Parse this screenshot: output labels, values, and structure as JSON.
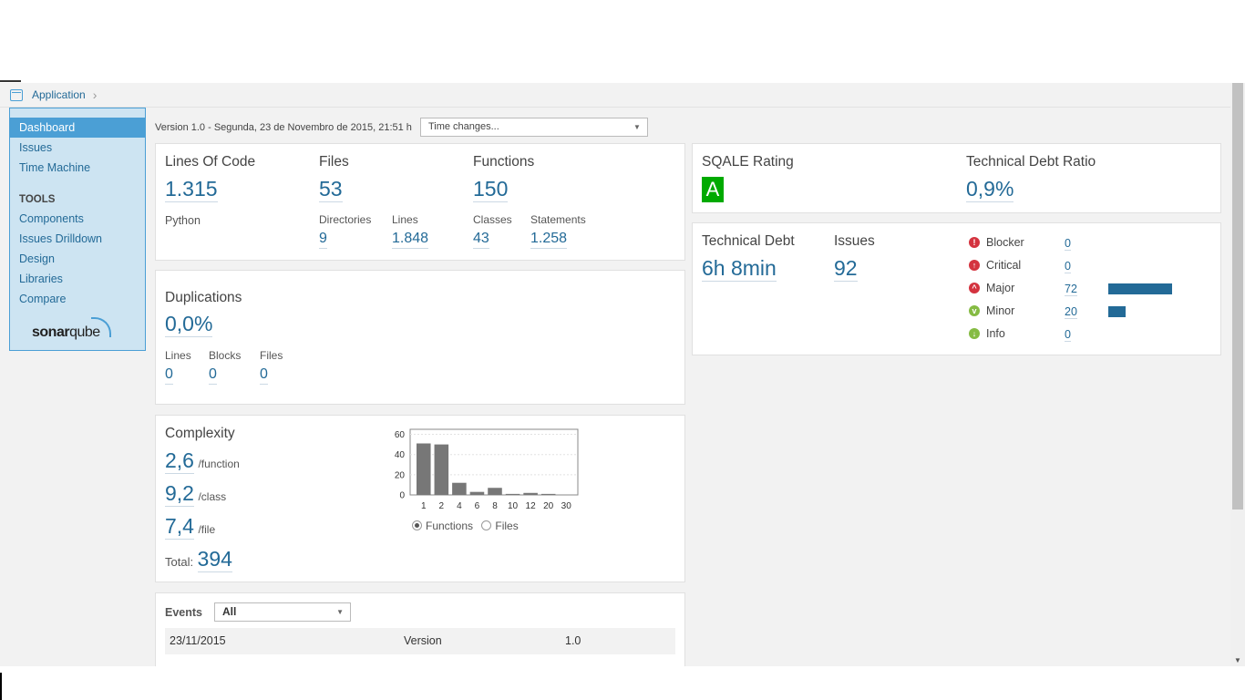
{
  "breadcrumb": {
    "label": "Application"
  },
  "sidebar": {
    "items": [
      {
        "label": "Dashboard"
      },
      {
        "label": "Issues"
      },
      {
        "label": "Time Machine"
      }
    ],
    "tools_label": "TOOLS",
    "tools": [
      {
        "label": "Components"
      },
      {
        "label": "Issues Drilldown"
      },
      {
        "label": "Design"
      },
      {
        "label": "Libraries"
      },
      {
        "label": "Compare"
      }
    ],
    "logo": {
      "part1": "sonar",
      "part2": "qube"
    }
  },
  "version": {
    "text": "Version 1.0 - Segunda, 23 de Novembro de 2015, 21:51 h",
    "select_value": "Time changes..."
  },
  "size": {
    "loc_label": "Lines Of Code",
    "loc_value": "1.315",
    "language": "Python",
    "files_label": "Files",
    "files_value": "53",
    "functions_label": "Functions",
    "functions_value": "150",
    "directories_label": "Directories",
    "directories_value": "9",
    "lines_label": "Lines",
    "lines_value": "1.848",
    "classes_label": "Classes",
    "classes_value": "43",
    "statements_label": "Statements",
    "statements_value": "1.258"
  },
  "duplications": {
    "title": "Duplications",
    "value": "0,0%",
    "lines_label": "Lines",
    "lines_value": "0",
    "blocks_label": "Blocks",
    "blocks_value": "0",
    "files_label": "Files",
    "files_value": "0"
  },
  "complexity": {
    "title": "Complexity",
    "per_function": "2,6",
    "per_function_label": "/function",
    "per_class": "9,2",
    "per_class_label": "/class",
    "per_file": "7,4",
    "per_file_label": "/file",
    "total_label": "Total:",
    "total_value": "394",
    "radio_functions": "Functions",
    "radio_files": "Files"
  },
  "chart_data": {
    "type": "bar",
    "categories": [
      "1",
      "2",
      "4",
      "6",
      "8",
      "10",
      "12",
      "20",
      "30"
    ],
    "values": [
      51,
      50,
      12,
      3,
      7,
      1,
      2,
      1,
      0
    ],
    "y_ticks": [
      "60",
      "40",
      "20",
      "0"
    ],
    "ylim": [
      0,
      65
    ],
    "bar_color": "#777777",
    "grid": true
  },
  "events": {
    "title": "Events",
    "filter_value": "All",
    "rows": [
      {
        "date": "23/11/2015",
        "type": "Version",
        "name": "1.0"
      }
    ]
  },
  "sqale": {
    "rating_label": "SQALE Rating",
    "rating_value": "A",
    "rating_color": "#00aa00",
    "ratio_label": "Technical Debt Ratio",
    "ratio_value": "0,9%"
  },
  "debt": {
    "label": "Technical Debt",
    "value": "6h 8min",
    "issues_label": "Issues",
    "issues_value": "92",
    "severities": [
      {
        "name": "Blocker",
        "count": "0",
        "color": "#d4333f",
        "icon": "blocker-icon",
        "glyph": "!"
      },
      {
        "name": "Critical",
        "count": "0",
        "color": "#d4333f",
        "icon": "critical-icon",
        "glyph": "↑"
      },
      {
        "name": "Major",
        "count": "72",
        "color": "#d4333f",
        "icon": "major-icon",
        "glyph": "^"
      },
      {
        "name": "Minor",
        "count": "20",
        "color": "#85bb43",
        "icon": "minor-icon",
        "glyph": "v"
      },
      {
        "name": "Info",
        "count": "0",
        "color": "#85bb43",
        "icon": "info-icon",
        "glyph": "↓"
      }
    ],
    "bar_color": "#236a97"
  }
}
